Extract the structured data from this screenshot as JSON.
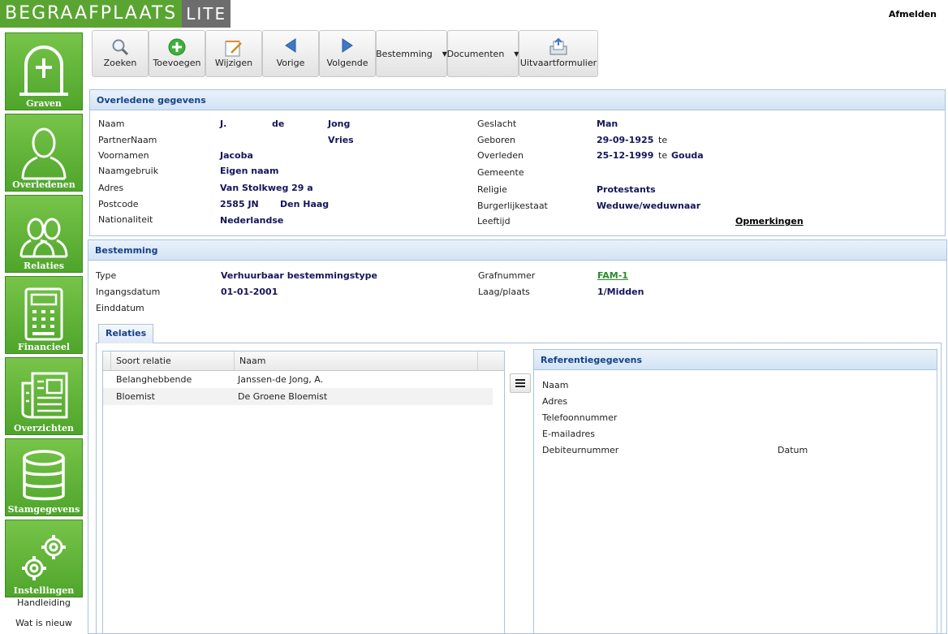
{
  "app": {
    "logo_main": "Begraafplaats",
    "logo_lite": "lite",
    "logout": "Afmelden"
  },
  "sidebar": {
    "items": [
      {
        "label": "Graven",
        "icon": "tombstone-icon"
      },
      {
        "label": "Overledenen",
        "icon": "person-icon"
      },
      {
        "label": "Relaties",
        "icon": "people-icon"
      },
      {
        "label": "Financieel",
        "icon": "calculator-icon"
      },
      {
        "label": "Overzichten",
        "icon": "newspaper-icon"
      },
      {
        "label": "Stamgegevens",
        "icon": "database-icon"
      },
      {
        "label": "Instellingen",
        "icon": "gears-icon"
      }
    ],
    "links": [
      "Handleiding",
      "Wat is nieuw"
    ]
  },
  "toolbar": {
    "zoeken": "Zoeken",
    "toevoegen": "Toevoegen",
    "wijzigen": "Wijzigen",
    "vorige": "Vorige",
    "volgende": "Volgende",
    "bestemming": "Bestemming",
    "documenten": "Documenten",
    "uitvaart": "Uitvaartformulier"
  },
  "deceased": {
    "title": "Overledene gegevens",
    "labels": {
      "naam": "Naam",
      "partner": "PartnerNaam",
      "voornamen": "Voornamen",
      "naamgebruik": "Naamgebruik",
      "adres": "Adres",
      "postcode": "Postcode",
      "nationaliteit": "Nationaliteit",
      "geslacht": "Geslacht",
      "geboren": "Geboren",
      "overleden": "Overleden",
      "gemeente": "Gemeente",
      "religie": "Religie",
      "burgerlijk": "Burgerlijkestaat",
      "leeftijd": "Leeftijd"
    },
    "values": {
      "initials": "J.",
      "tussenvoegsel": "de",
      "achternaam": "Jong",
      "partner": "Vries",
      "voornamen": "Jacoba",
      "naamgebruik": "Eigen naam",
      "adres": "Van Stolkweg 29 a",
      "postcode": "2585 JN",
      "plaats": "Den Haag",
      "nationaliteit": "Nederlandse",
      "geslacht": "Man",
      "geboren": "29-09-1925",
      "geboren_te": "te",
      "overleden": "25-12-1999",
      "overleden_te": "te",
      "overleden_plaats": "Gouda",
      "religie": "Protestants",
      "burgerlijk": "Weduwe/weduwnaar",
      "opmerkingen": "Opmerkingen"
    }
  },
  "destination": {
    "title": "Bestemming",
    "labels": {
      "type": "Type",
      "ingang": "Ingangsdatum",
      "eind": "Einddatum",
      "graf": "Grafnummer",
      "laag": "Laag/plaats"
    },
    "values": {
      "type": "Verhuurbaar bestemmingstype",
      "ingang": "01-01-2001",
      "graf": "FAM-1",
      "laag": "1/Midden"
    }
  },
  "tabs": {
    "relaties": "Relaties"
  },
  "relations": {
    "columns": [
      "Soort relatie",
      "Naam"
    ],
    "rows": [
      {
        "soort": "Belanghebbende",
        "naam": "Janssen-de Jong, A."
      },
      {
        "soort": "Bloemist",
        "naam": "De Groene Bloemist"
      }
    ]
  },
  "reference": {
    "title": "Referentiegegevens",
    "labels": {
      "naam": "Naam",
      "adres": "Adres",
      "telefoon": "Telefoonnummer",
      "email": "E-mailadres",
      "debiteur": "Debiteurnummer",
      "datum": "Datum"
    }
  },
  "colors": {
    "brand_green": "#5aa532",
    "panel_blue": "#15428b",
    "value_navy": "#15155b"
  }
}
